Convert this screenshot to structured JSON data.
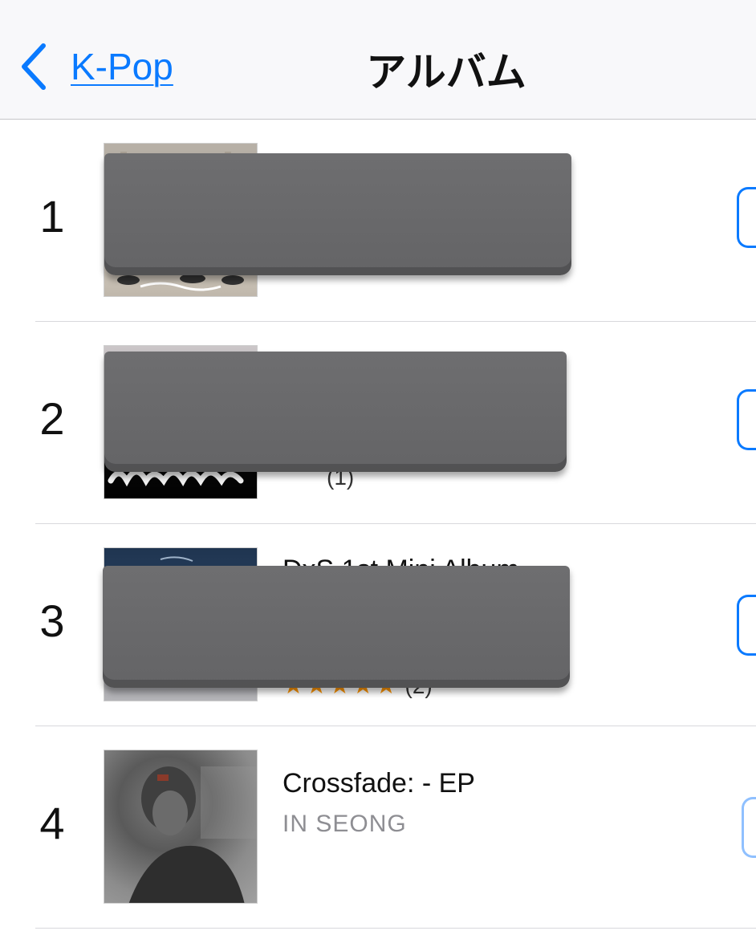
{
  "nav": {
    "back_label": "K-Pop",
    "title": "アルバム"
  },
  "albums": [
    {
      "rank": "1",
      "name": "",
      "artist": "",
      "rating_count": ""
    },
    {
      "rank": "2",
      "name": "",
      "artist": "",
      "rating_count": "(1)"
    },
    {
      "rank": "3",
      "name": "DxS 1st Mini Album",
      "artist": "",
      "rating_count": "(2)"
    },
    {
      "rank": "4",
      "name": "Crossfade: - EP",
      "artist": "IN SEONG",
      "rating_count": ""
    }
  ],
  "colors": {
    "accent": "#0a7aff",
    "star": "#ff9500",
    "redaction": "#68686a"
  }
}
